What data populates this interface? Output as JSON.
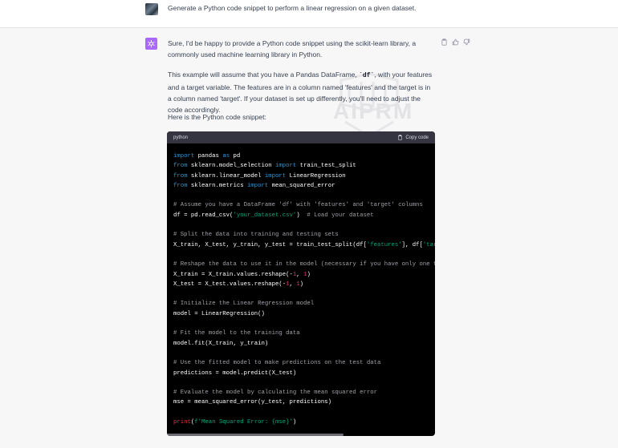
{
  "user_message": {
    "text": "Generate a Python code snippet to perform a linear regression on a given dataset."
  },
  "assistant_message": {
    "p1": "Sure, I'd be happy to provide a Python code snippet using the scikit-learn library, a commonly used machine learning library in Python.",
    "p2_before": "This example will assume that you have a Pandas DataFrame, ",
    "p2_code": "`df`",
    "p2_after": ", with your features and a target variable. The features are in a column named 'features' and the target is in a column named 'target'. If your dataset is set up differently, you'll need to adjust the code accordingly.",
    "p3": "Here is the Python code snippet:"
  },
  "watermark": {
    "text": "AIPRM"
  },
  "code_block": {
    "language": "python",
    "copy_label": "Copy code",
    "lines": [
      [
        [
          "kw",
          "import"
        ],
        [
          "tx",
          " pandas "
        ],
        [
          "kw",
          "as"
        ],
        [
          "tx",
          " pd"
        ]
      ],
      [
        [
          "kw",
          "from"
        ],
        [
          "tx",
          " sklearn.model_selection "
        ],
        [
          "kw",
          "import"
        ],
        [
          "tx",
          " train_test_split"
        ]
      ],
      [
        [
          "kw",
          "from"
        ],
        [
          "tx",
          " sklearn.linear_model "
        ],
        [
          "kw",
          "import"
        ],
        [
          "tx",
          " LinearRegression"
        ]
      ],
      [
        [
          "kw",
          "from"
        ],
        [
          "tx",
          " sklearn.metrics "
        ],
        [
          "kw",
          "import"
        ],
        [
          "tx",
          " mean_squared_error"
        ]
      ],
      [],
      [
        [
          "cm",
          "# Assume you have a DataFrame 'df' with 'features' and 'target' columns"
        ]
      ],
      [
        [
          "tx",
          "df = pd.read_csv("
        ],
        [
          "str",
          "'your_dataset.csv'"
        ],
        [
          "tx",
          ")  "
        ],
        [
          "cm",
          "# Load your dataset"
        ]
      ],
      [],
      [
        [
          "cm",
          "# Split the data into training and testing sets"
        ]
      ],
      [
        [
          "tx",
          "X_train, X_test, y_train, y_test = train_test_split(df["
        ],
        [
          "str",
          "'features'"
        ],
        [
          "tx",
          "], df["
        ],
        [
          "str",
          "'target'"
        ],
        [
          "tx",
          "], test_size="
        ],
        [
          "num",
          "0.2"
        ],
        [
          "tx",
          ", random_state="
        ],
        [
          "num",
          "42"
        ],
        [
          "tx",
          ")"
        ]
      ],
      [],
      [
        [
          "cm",
          "# Reshape the data to use it in the model (necessary if you have only one feature)"
        ]
      ],
      [
        [
          "tx",
          "X_train = X_train.values.reshape(-"
        ],
        [
          "num",
          "1"
        ],
        [
          "tx",
          ", "
        ],
        [
          "num",
          "1"
        ],
        [
          "tx",
          ")"
        ]
      ],
      [
        [
          "tx",
          "X_test = X_test.values.reshape(-"
        ],
        [
          "num",
          "1"
        ],
        [
          "tx",
          ", "
        ],
        [
          "num",
          "1"
        ],
        [
          "tx",
          ")"
        ]
      ],
      [],
      [
        [
          "cm",
          "# Initialize the Linear Regression model"
        ]
      ],
      [
        [
          "tx",
          "model = LinearRegression()"
        ]
      ],
      [],
      [
        [
          "cm",
          "# Fit the model to the training data"
        ]
      ],
      [
        [
          "tx",
          "model.fit(X_train, y_train)"
        ]
      ],
      [],
      [
        [
          "cm",
          "# Use the fitted model to make predictions on the test data"
        ]
      ],
      [
        [
          "tx",
          "predictions = model.predict(X_test)"
        ]
      ],
      [],
      [
        [
          "cm",
          "# Evaluate the model by calculating the mean squared error"
        ]
      ],
      [
        [
          "tx",
          "mse = mean_squared_error(y_test, predictions)"
        ]
      ],
      [],
      [
        [
          "fn",
          "print"
        ],
        [
          "tx",
          "("
        ],
        [
          "str",
          "f'Mean Squared Error: {mse}'"
        ],
        [
          "tx",
          ")"
        ]
      ]
    ]
  },
  "icons": {
    "user_avatar": "user-avatar-image",
    "assistant_avatar": "openai-logo-icon",
    "copy_message": "clipboard-icon",
    "thumbs_up": "thumbs-up-icon",
    "thumbs_down": "thumbs-down-icon",
    "copy_code": "clipboard-icon"
  },
  "colors": {
    "assistant_avatar_bg": "#ab68ff",
    "code_bg": "#000000",
    "code_header_bg": "#343541",
    "keyword": "#2e95d3",
    "comment": "#a0a1a7",
    "string": "#00a67d",
    "number": "#df3079",
    "builtin": "#f22c3d"
  }
}
